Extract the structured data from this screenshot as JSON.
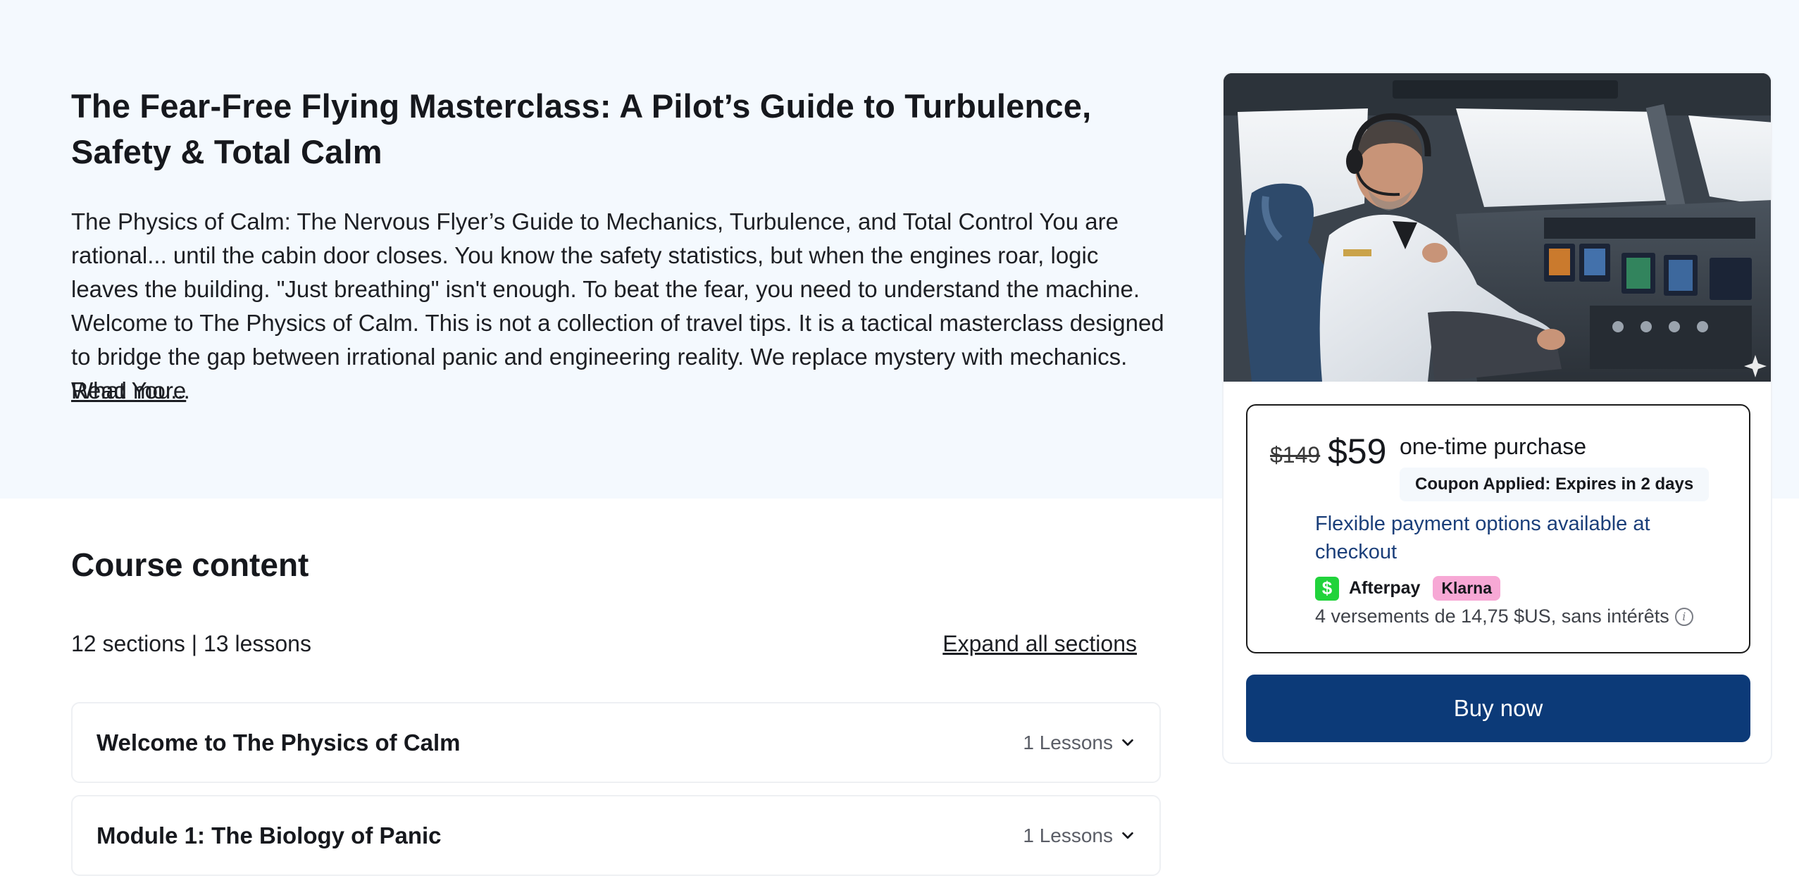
{
  "course": {
    "title": "The Fear-Free Flying Masterclass: A Pilot’s Guide to Turbulence, Safety & Total Calm",
    "description": "The Physics of Calm: The Nervous Flyer’s Guide to Mechanics, Turbulence, and Total Control You are rational... until the cabin door closes. You know the safety statistics, but when the engines roar, logic leaves the building. \"Just breathing\" isn't enough. To beat the fear, you need to understand the machine. Welcome to The Physics of Calm. This is not a collection of travel tips. It is a tactical masterclass designed to bridge the gap between irrational panic and engineering reality. We replace mystery with mechanics. What You...",
    "read_more": "Read more"
  },
  "content": {
    "heading": "Course content",
    "meta": "12 sections | 13 lessons",
    "expand_all": "Expand all sections",
    "sections": [
      {
        "title": "Welcome to The Physics of Calm",
        "count": "1 Lessons"
      },
      {
        "title": "Module 1: The Biology of Panic",
        "count": "1 Lessons"
      }
    ]
  },
  "purchase": {
    "old_price": "$149",
    "new_price": "$59",
    "one_time": "one-time purchase",
    "coupon": "Coupon Applied: Expires in 2 days",
    "flexible": "Flexible payment options available at checkout",
    "afterpay_icon": "$",
    "afterpay": "Afterpay",
    "klarna": "Klarna",
    "installments": "4 versements de 14,75 $US, sans intérêts",
    "buy_label": "Buy now"
  },
  "icons": {
    "chevron": "chevron-down-icon",
    "info": "info-icon",
    "sparkle": "sparkle-icon"
  },
  "colors": {
    "hero_bg": "#f4f9fe",
    "primary": "#0c3a78",
    "link": "#1b3f7a",
    "afterpay": "#21d33b",
    "klarna": "#f7a8d5"
  }
}
